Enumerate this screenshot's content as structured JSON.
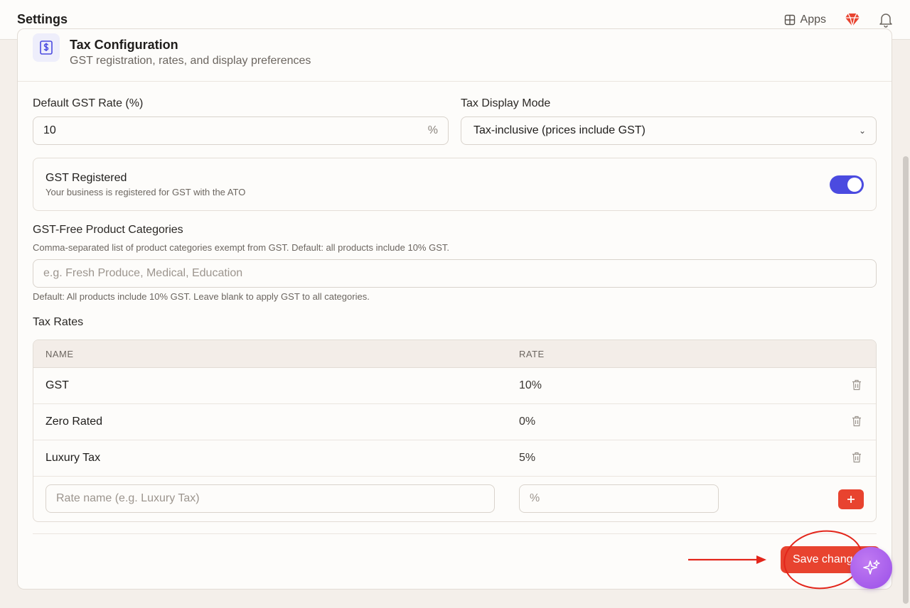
{
  "header": {
    "title": "Settings",
    "apps_label": "Apps"
  },
  "card": {
    "title": "Tax Configuration",
    "subtitle": "GST registration, rates, and display preferences"
  },
  "gst_rate": {
    "label": "Default GST Rate (%)",
    "value": "10",
    "suffix": "%"
  },
  "display_mode": {
    "label": "Tax Display Mode",
    "selected": "Tax-inclusive (prices include GST)",
    "chevron": "⌄"
  },
  "gst_registered": {
    "title": "GST Registered",
    "description": "Your business is registered for GST with the ATO",
    "enabled": true
  },
  "gst_free": {
    "label": "GST-Free Product Categories",
    "description": "Comma-separated list of product categories exempt from GST. Default: all products include 10% GST.",
    "placeholder": "e.g. Fresh Produce, Medical, Education",
    "value": "",
    "help": "Default: All products include 10% GST. Leave blank to apply GST to all categories."
  },
  "tax_rates": {
    "label": "Tax Rates",
    "columns": [
      "NAME",
      "RATE"
    ],
    "rows": [
      {
        "name": "GST",
        "rate": "10%"
      },
      {
        "name": "Zero Rated",
        "rate": "0%"
      },
      {
        "name": "Luxury Tax",
        "rate": "5%"
      }
    ],
    "new_name_placeholder": "Rate name (e.g. Luxury Tax)",
    "new_rate_placeholder": "%",
    "add_label": "+"
  },
  "save_label": "Save changes",
  "colors": {
    "accent": "#e8432f",
    "toggle": "#4b4be0",
    "annotation": "#e3261b",
    "fab": "#a85cec"
  }
}
